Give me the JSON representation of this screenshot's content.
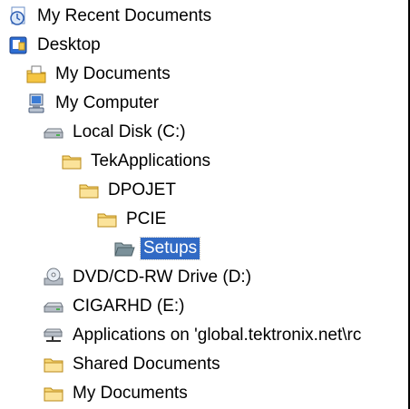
{
  "tree": {
    "items": [
      {
        "label": "My Recent Documents",
        "icon": "recent-documents-icon",
        "depth": 0
      },
      {
        "label": "Desktop",
        "icon": "desktop-icon",
        "depth": 0
      },
      {
        "label": "My Documents",
        "icon": "my-documents-icon",
        "depth": 1
      },
      {
        "label": "My Computer",
        "icon": "my-computer-icon",
        "depth": 1
      },
      {
        "label": "Local Disk (C:)",
        "icon": "hard-drive-icon",
        "depth": 2
      },
      {
        "label": "TekApplications",
        "icon": "folder-icon",
        "depth": 3
      },
      {
        "label": "DPOJET",
        "icon": "folder-icon",
        "depth": 4
      },
      {
        "label": "PCIE",
        "icon": "folder-icon",
        "depth": 5
      },
      {
        "label": "Setups",
        "icon": "folder-open-icon",
        "depth": 6,
        "selected": true
      },
      {
        "label": "DVD/CD-RW Drive (D:)",
        "icon": "cd-drive-icon",
        "depth": 2
      },
      {
        "label": "CIGARHD (E:)",
        "icon": "hard-drive-icon",
        "depth": 2
      },
      {
        "label": "Applications on 'global.tektronix.net\\rc",
        "icon": "network-drive-icon",
        "depth": 2
      },
      {
        "label": "Shared Documents",
        "icon": "folder-icon",
        "depth": 2
      },
      {
        "label": "My Documents",
        "icon": "folder-icon",
        "depth": 2
      }
    ]
  },
  "colors": {
    "selection": "#316ac5",
    "folder": "#f7d775",
    "folder_open": "#7a9099"
  }
}
